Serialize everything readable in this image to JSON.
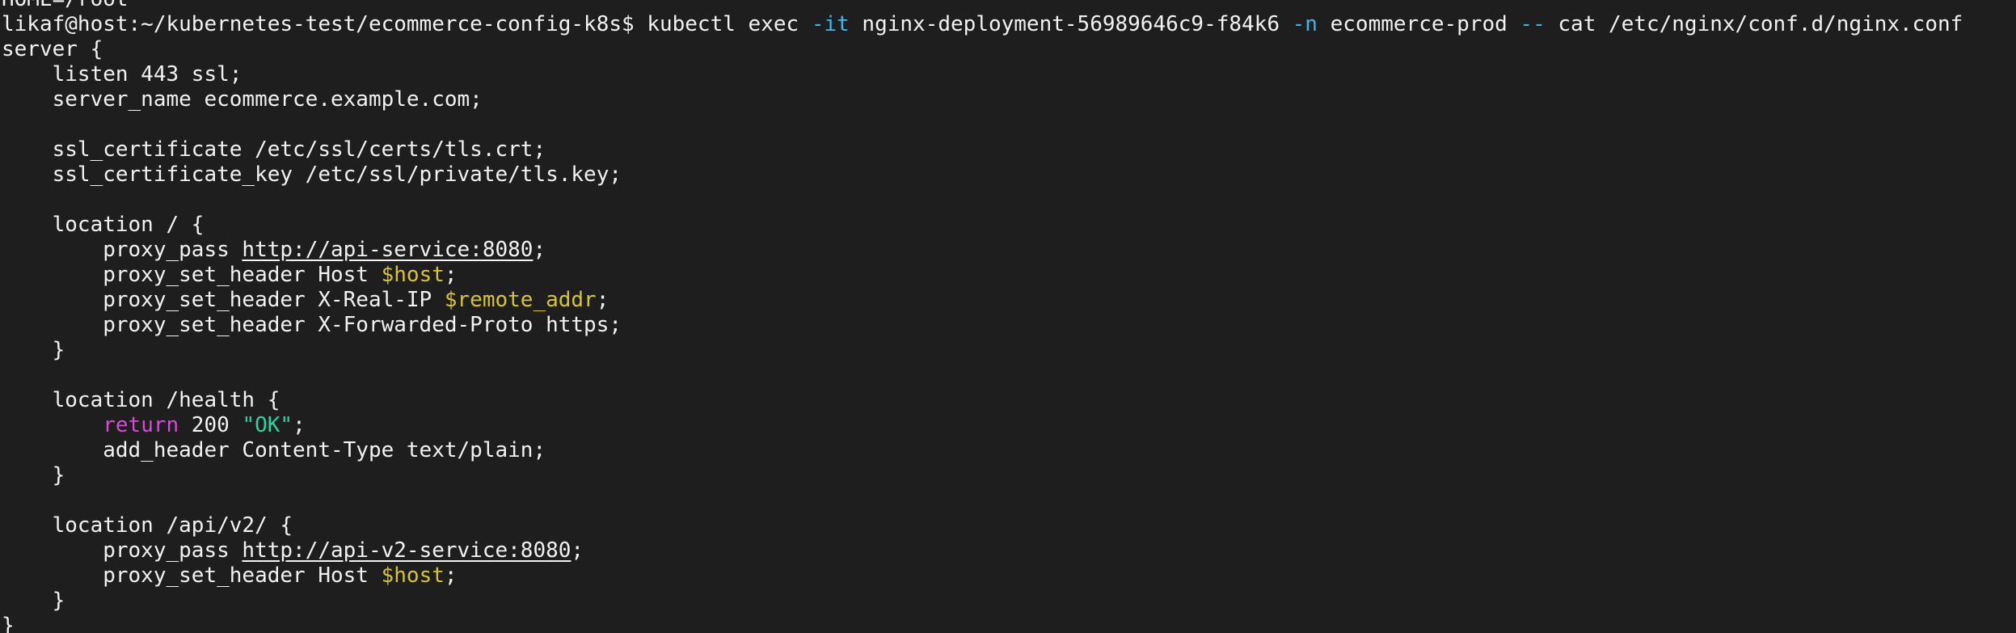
{
  "terminal": {
    "colors": {
      "background": "#1e1e1e",
      "foreground": "#f2f2f2",
      "flag": "#3bb8e6",
      "variable": "#d6c531",
      "keyword": "#d14ed1",
      "string": "#30d0a0"
    },
    "lines": [
      [
        {
          "t": "HOME=/root",
          "k": ""
        }
      ],
      [
        {
          "t": "likaf@host:~/kubernetes-test/ecommerce-config-k8s$ kubectl exec ",
          "k": ""
        },
        {
          "t": "-it",
          "k": "flag"
        },
        {
          "t": " nginx-deployment-56989646c9-f84k6 ",
          "k": ""
        },
        {
          "t": "-n",
          "k": "flag"
        },
        {
          "t": " ecommerce-prod ",
          "k": ""
        },
        {
          "t": "--",
          "k": "flag"
        },
        {
          "t": " cat /etc/nginx/conf.d/nginx.conf",
          "k": ""
        }
      ],
      [
        {
          "t": "server {",
          "k": ""
        }
      ],
      [
        {
          "t": "    listen 443 ssl;",
          "k": ""
        }
      ],
      [
        {
          "t": "    server_name ecommerce.example.com;",
          "k": ""
        }
      ],
      [
        {
          "t": "",
          "k": ""
        }
      ],
      [
        {
          "t": "    ssl_certificate /etc/ssl/certs/tls.crt;",
          "k": ""
        }
      ],
      [
        {
          "t": "    ssl_certificate_key /etc/ssl/private/tls.key;",
          "k": ""
        }
      ],
      [
        {
          "t": "",
          "k": ""
        }
      ],
      [
        {
          "t": "    location / {",
          "k": ""
        }
      ],
      [
        {
          "t": "        proxy_pass ",
          "k": ""
        },
        {
          "t": "http://api-service:8080",
          "k": "url"
        },
        {
          "t": ";",
          "k": ""
        }
      ],
      [
        {
          "t": "        proxy_set_header Host ",
          "k": ""
        },
        {
          "t": "$host",
          "k": "var"
        },
        {
          "t": ";",
          "k": ""
        }
      ],
      [
        {
          "t": "        proxy_set_header X-Real-IP ",
          "k": ""
        },
        {
          "t": "$remote_addr",
          "k": "var"
        },
        {
          "t": ";",
          "k": ""
        }
      ],
      [
        {
          "t": "        proxy_set_header X-Forwarded-Proto https;",
          "k": ""
        }
      ],
      [
        {
          "t": "    }",
          "k": ""
        }
      ],
      [
        {
          "t": "",
          "k": ""
        }
      ],
      [
        {
          "t": "    location /health {",
          "k": ""
        }
      ],
      [
        {
          "t": "        ",
          "k": ""
        },
        {
          "t": "return",
          "k": "kw"
        },
        {
          "t": " 200 ",
          "k": ""
        },
        {
          "t": "\"OK\"",
          "k": "str"
        },
        {
          "t": ";",
          "k": ""
        }
      ],
      [
        {
          "t": "        add_header Content-Type text/plain;",
          "k": ""
        }
      ],
      [
        {
          "t": "    }",
          "k": ""
        }
      ],
      [
        {
          "t": "",
          "k": ""
        }
      ],
      [
        {
          "t": "    location /api/v2/ {",
          "k": ""
        }
      ],
      [
        {
          "t": "        proxy_pass ",
          "k": ""
        },
        {
          "t": "http://api-v2-service:8080",
          "k": "url"
        },
        {
          "t": ";",
          "k": ""
        }
      ],
      [
        {
          "t": "        proxy_set_header Host ",
          "k": ""
        },
        {
          "t": "$host",
          "k": "var"
        },
        {
          "t": ";",
          "k": ""
        }
      ],
      [
        {
          "t": "    }",
          "k": ""
        }
      ],
      [
        {
          "t": "}",
          "k": ""
        }
      ]
    ]
  }
}
